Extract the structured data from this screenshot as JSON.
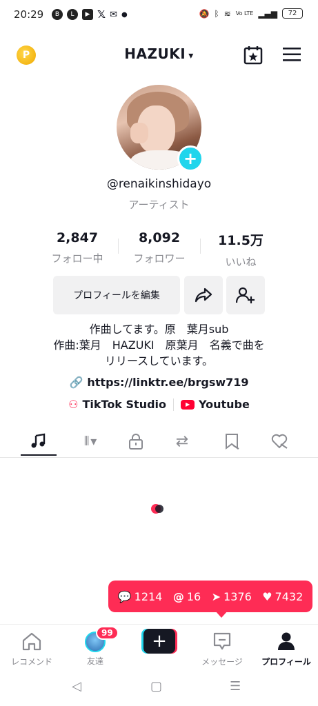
{
  "status_bar": {
    "time": "20:29",
    "battery": "72",
    "network": "Vo LTE"
  },
  "header": {
    "account_name": "HAZUKI",
    "dropdown_glyph": "⌄",
    "coin_glyph": "P"
  },
  "profile": {
    "username": "@renaikinshidayo",
    "category": "アーティスト"
  },
  "stats": [
    {
      "value": "2,847",
      "label": "フォロー中"
    },
    {
      "value": "8,092",
      "label": "フォロワー"
    },
    {
      "value": "11.5万",
      "label": "いいね"
    }
  ],
  "actions": {
    "edit_profile": "プロフィールを編集"
  },
  "bio": {
    "line1": "作曲してます。原　葉月sub",
    "line2": "作曲:葉月　HAZUKI　原葉月　名義で曲を",
    "line3": "リリースしています。",
    "link": "https://linktr.ee/brgsw719",
    "tiktok_studio": "TikTok Studio",
    "youtube": "Youtube"
  },
  "notifications_popup": {
    "comments": "1214",
    "mentions": "16",
    "shares": "1376",
    "likes": "7432"
  },
  "bottom_nav": {
    "home": "レコメンド",
    "friends": "友達",
    "friends_badge": "99",
    "messages": "メッセージ",
    "profile": "プロフィール"
  },
  "colors": {
    "accent": "#fe2c55",
    "cyan": "#20d5ec",
    "text": "#161823",
    "muted": "#8a8b91"
  }
}
